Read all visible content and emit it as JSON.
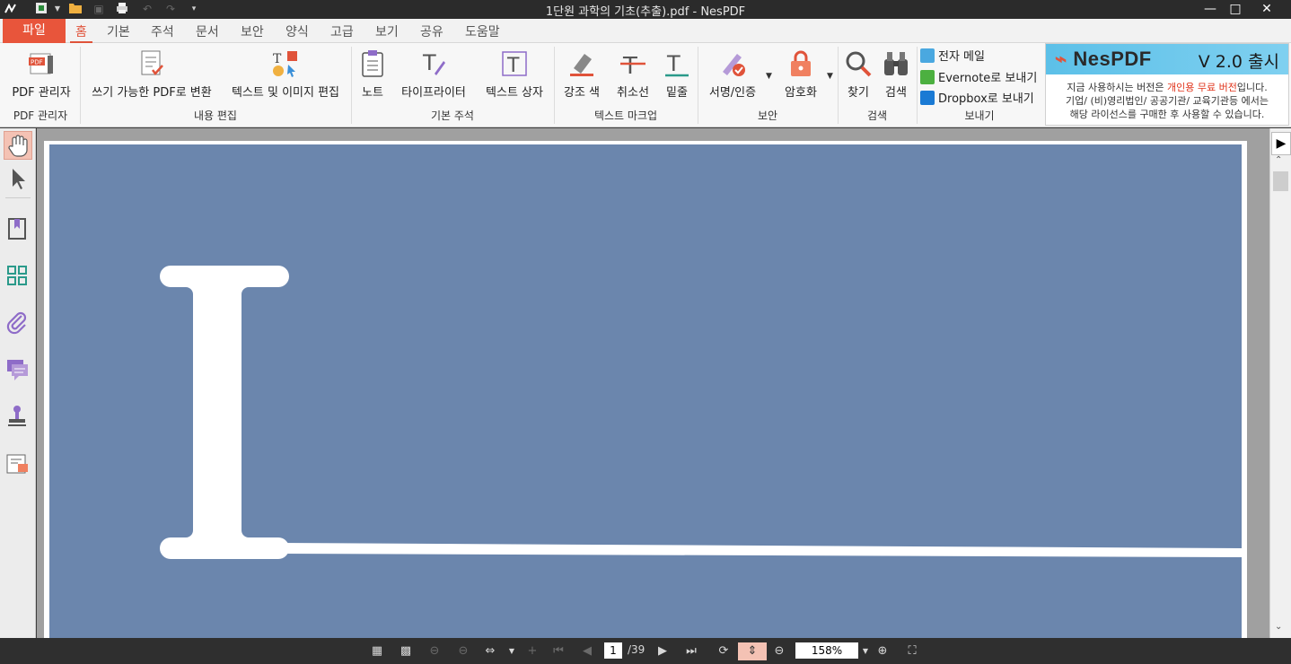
{
  "window": {
    "title": "1단원 과학의 기초(추출).pdf - NesPDF",
    "minimize": "—",
    "maximize": "□",
    "close": "✕"
  },
  "menu": {
    "tabs": [
      "파일",
      "홈",
      "기본",
      "주석",
      "문서",
      "보안",
      "양식",
      "고급",
      "보기",
      "공유",
      "도움말"
    ],
    "active": "홈"
  },
  "ribbon": {
    "buttons": {
      "pdf_manager": "PDF 관리자",
      "convert_writable": "쓰기 가능한 PDF로 변환",
      "edit_text_image": "텍스트 및 이미지 편집",
      "note": "노트",
      "typewriter": "타이프라이터",
      "textbox": "텍스트 상자",
      "highlight": "강조 색",
      "strikeout": "취소선",
      "underline": "밑줄",
      "sign": "서명/인증",
      "encrypt": "암호화",
      "find": "찾기",
      "search": "검색"
    },
    "share": {
      "email": "전자 메일",
      "evernote": "Evernote로 보내기",
      "dropbox": "Dropbox로 보내기"
    },
    "groups": {
      "pdf_manager": "PDF 관리자",
      "content_edit": "내용 편집",
      "basic_annot": "기본 주석",
      "text_markup": "텍스트 마크업",
      "security": "보안",
      "search": "검색",
      "send": "보내기"
    }
  },
  "promo": {
    "brand": "NesPDF",
    "version": "V 2.0 출시",
    "line1_pre": "지금 사용하시는 버전은 ",
    "line1_hl": "개인용 무료 버전",
    "line1_post": "입니다.",
    "line2": "기업/ (비)영리법인/ 공공기관/ 교육기관등 에서는",
    "line3": "해당 라이선스를 구매한 후 사용할 수 있습니다."
  },
  "statusbar": {
    "page_current": "1",
    "page_total": "/39",
    "zoom": "158%"
  },
  "colors": {
    "accent": "#e0533a",
    "page_bg": "#6b86ad"
  }
}
